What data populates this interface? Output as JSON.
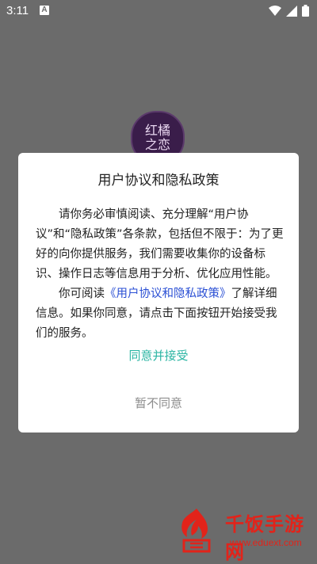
{
  "status_bar": {
    "time": "3:11",
    "notification_letter": "A"
  },
  "app_logo": {
    "line1": "红橘",
    "line2": "之恋"
  },
  "dialog": {
    "title": "用户协议和隐私政策",
    "para1": "请你务必审慎阅读、充分理解“用户协议”和“隐私政策”各条款，包括但不限于：为了更好的向你提供服务，我们需要收集你的设备标识、操作日志等信息用于分析、优化应用性能。",
    "para2_prefix": "你可阅读",
    "para2_link": "《用户协议和隐私政策》",
    "para2_suffix": "了解详细信息。如果你同意，请点击下面按钮开始接受我们的服务。",
    "agree_label": "同意并接受",
    "disagree_label": "暂不同意"
  },
  "watermark": {
    "text": "千饭手游网",
    "url": "www.eduext.com"
  }
}
